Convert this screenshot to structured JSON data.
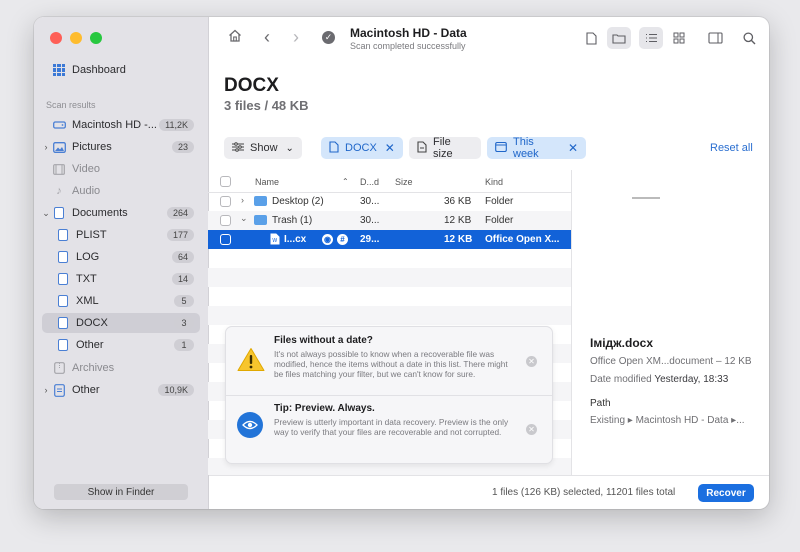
{
  "window": {
    "title": "Macintosh HD - Data",
    "subtitle": "Scan completed successfully"
  },
  "sidebar": {
    "dashboard_label": "Dashboard",
    "section_label": "Scan results",
    "items": [
      {
        "label": "Macintosh HD -...",
        "count": "11,2K"
      },
      {
        "label": "Pictures",
        "count": "23"
      },
      {
        "label": "Video",
        "count": ""
      },
      {
        "label": "Audio",
        "count": ""
      },
      {
        "label": "Documents",
        "count": "264"
      },
      {
        "label": "PLIST",
        "count": "177"
      },
      {
        "label": "LOG",
        "count": "64"
      },
      {
        "label": "TXT",
        "count": "14"
      },
      {
        "label": "XML",
        "count": "5"
      },
      {
        "label": "DOCX",
        "count": "3"
      },
      {
        "label": "Other",
        "count": "1"
      },
      {
        "label": "Archives",
        "count": ""
      },
      {
        "label": "Other",
        "count": "10,9K"
      }
    ],
    "show_in_finder": "Show in Finder"
  },
  "header": {
    "title": "DOCX",
    "subtitle": "3 files / 48 KB"
  },
  "filters": {
    "show_label": "Show",
    "chips": [
      "DOCX",
      "File size",
      "This week"
    ],
    "reset_label": "Reset all"
  },
  "table": {
    "columns": {
      "name": "Name",
      "date": "D...d",
      "size": "Size",
      "kind": "Kind"
    },
    "rows": [
      {
        "name": "Desktop (2)",
        "date": "30...",
        "size": "36 KB",
        "kind": "Folder"
      },
      {
        "name": "Trash (1)",
        "date": "30...",
        "size": "12 KB",
        "kind": "Folder"
      },
      {
        "name": "I...cx",
        "date": "29...",
        "size": "12 KB",
        "kind": "Office Open X..."
      }
    ]
  },
  "tips": [
    {
      "title": "Files without a date?",
      "body": "It's not always possible to know when a recoverable file was modified, hence the items without a date in this list. There might be files matching your filter, but we can't know for sure."
    },
    {
      "title": "Tip: Preview. Always.",
      "body": "Preview is utterly important in data recovery. Preview is the only way to verify that your files are recoverable and not corrupted."
    }
  ],
  "preview": {
    "filename": "Імідж.docx",
    "type_line": "Office Open XM...document – 12 KB",
    "date_label": "Date modified",
    "date_value": "Yesterday, 18:33",
    "path_label": "Path",
    "path_value": "Existing ▸ Macintosh HD - Data ▸..."
  },
  "footer": {
    "status": "1 files (126 KB) selected, 11201 files total",
    "recover_label": "Recover"
  },
  "colors": {
    "accent": "#1b6fe0",
    "selection": "#1262d8",
    "chip_blue": "#d4e6fb"
  }
}
